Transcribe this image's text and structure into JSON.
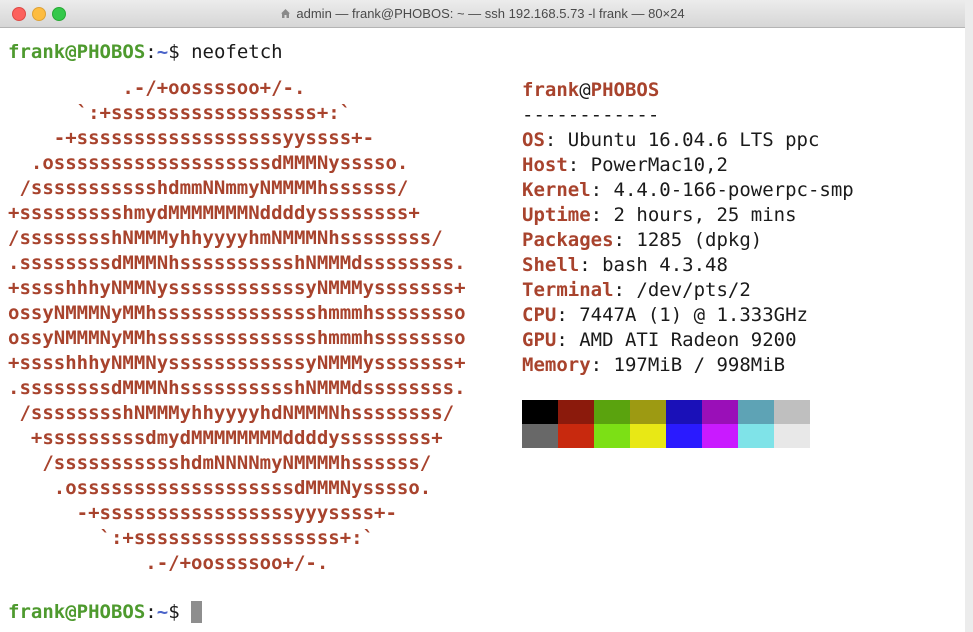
{
  "window": {
    "title": "admin — frank@PHOBOS: ~ — ssh 192.168.5.73 -l frank — 80×24"
  },
  "prompt": {
    "user_host": "frank@PHOBOS",
    "colon": ":",
    "path": "~",
    "dollar": "$",
    "command": " neofetch"
  },
  "ascii_art": [
    "          .-/+oossssoo+/-.",
    "      `:+ssssssssssssssssss+:`",
    "    -+ssssssssssssssssssyyssss+-",
    "  .osssssssssssssssssssdMMMNysssso.",
    " /ssssssssssshdmmNNmmyNMMMMhssssss/",
    "+ssssssssshmydMMMMMMMNddddyssssssss+",
    "/sssssssshNMMMyhhyyyyhmNMMMNhssssssss/",
    ".ssssssssdMMMNhsssssssssshNMMMdssssssss.",
    "+sssshhhyNMMNyssssssssssssyNMMMysssssss+",
    "ossyNMMMNyMMhsssssssssssssshmmmhssssssso",
    "ossyNMMMNyMMhsssssssssssssshmmmhssssssso",
    "+sssshhhyNMMNyssssssssssssyNMMMysssssss+",
    ".ssssssssdMMMNhsssssssssshNMMMdssssssss.",
    " /sssssssshNMMMyhhyyyyhdNMMMNhssssssss/",
    "  +sssssssssdmydMMMMMMMMddddyssssssss+",
    "   /ssssssssssshdmNNNNmyNMMMMhssssss/",
    "    .osssssssssssssssssssdMMMNysssso.",
    "      -+sssssssssssssssssyyyssss+-",
    "        `:+ssssssssssssssssss+:`",
    "            .-/+oossssoo+/-."
  ],
  "info": {
    "user": "frank",
    "at": "@",
    "host": "PHOBOS",
    "separator": "------------",
    "rows": [
      {
        "key": "OS",
        "value": " Ubuntu 16.04.6 LTS ppc"
      },
      {
        "key": "Host",
        "value": " PowerMac10,2"
      },
      {
        "key": "Kernel",
        "value": " 4.4.0-166-powerpc-smp"
      },
      {
        "key": "Uptime",
        "value": " 2 hours, 25 mins"
      },
      {
        "key": "Packages",
        "value": " 1285 (dpkg)"
      },
      {
        "key": "Shell",
        "value": " bash 4.3.48"
      },
      {
        "key": "Terminal",
        "value": " /dev/pts/2"
      },
      {
        "key": "CPU",
        "value": " 7447A (1) @ 1.333GHz"
      },
      {
        "key": "GPU",
        "value": " AMD ATI Radeon 9200"
      },
      {
        "key": "Memory",
        "value": " 197MiB / 998MiB"
      }
    ]
  },
  "palette": {
    "row1": [
      "#000000",
      "#8b1a0c",
      "#5aa30e",
      "#9d9a12",
      "#1a10b8",
      "#9a0fb8",
      "#5ea3b5",
      "#bfbfbf"
    ],
    "row2": [
      "#686868",
      "#c8290e",
      "#7ce015",
      "#e8e815",
      "#2a1aff",
      "#c91aff",
      "#7fe3e8",
      "#e8e8e8"
    ]
  },
  "colors": {
    "prompt_user": "#4e9a2e",
    "prompt_path": "#4b64c9",
    "accent": "#a8432d",
    "cursor": "#8e8e8e"
  }
}
